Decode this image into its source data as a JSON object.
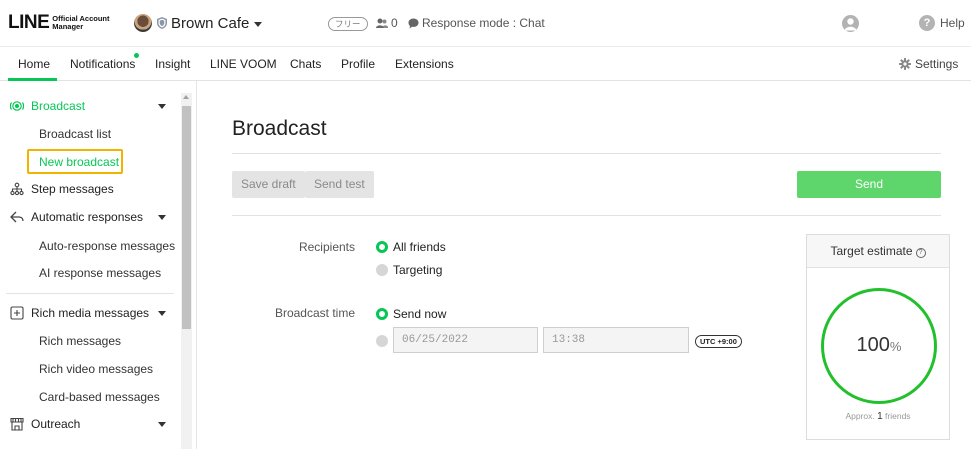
{
  "brand": {
    "logo_text": "LINE",
    "logo_sub_line1": "Official Account",
    "logo_sub_line2": "Manager"
  },
  "account": {
    "name": "Brown Cafe",
    "plan_badge": "フリー",
    "friends_count": "0",
    "response_mode": "Response mode : Chat"
  },
  "header": {
    "help_label": "Help"
  },
  "nav": {
    "tabs": [
      {
        "label": "Home"
      },
      {
        "label": "Notifications"
      },
      {
        "label": "Insight"
      },
      {
        "label": "LINE VOOM"
      },
      {
        "label": "Chats"
      },
      {
        "label": "Profile"
      },
      {
        "label": "Extensions"
      }
    ],
    "settings_label": "Settings"
  },
  "sidebar": {
    "broadcast": "Broadcast",
    "broadcast_list": "Broadcast list",
    "new_broadcast": "New broadcast",
    "step_messages": "Step messages",
    "automatic_responses": "Automatic responses",
    "auto_response_messages": "Auto-response messages",
    "ai_response_messages": "AI response messages",
    "rich_media_messages": "Rich media messages",
    "rich_messages": "Rich messages",
    "rich_video_messages": "Rich video messages",
    "card_based_messages": "Card-based messages",
    "outreach": "Outreach"
  },
  "main": {
    "title": "Broadcast",
    "save_draft": "Save draft",
    "send_test": "Send test",
    "send": "Send",
    "recipients_label": "Recipients",
    "all_friends": "All friends",
    "targeting": "Targeting",
    "broadcast_time_label": "Broadcast time",
    "send_now": "Send now",
    "date_value": "06/25/2022",
    "time_value": "13:38",
    "timezone": "UTC +9:00"
  },
  "target": {
    "title": "Target estimate",
    "percent_value": "100",
    "percent_sign": "%",
    "approx_prefix": "Approx.",
    "approx_count": "1",
    "approx_suffix": "friends"
  },
  "colors": {
    "accent": "#06c755",
    "send_button": "#5fd66b",
    "highlight": "#f0b400"
  }
}
